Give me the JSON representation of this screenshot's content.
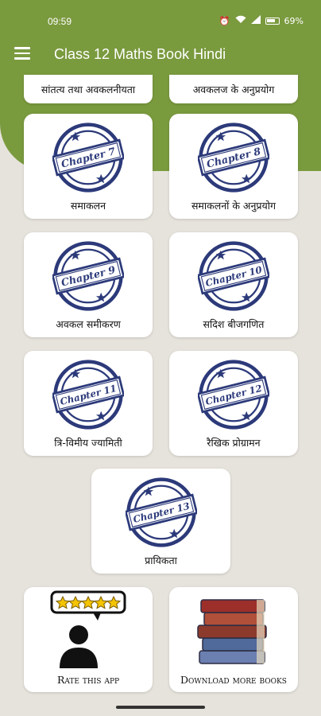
{
  "statusbar": {
    "time": "09:59",
    "battery": "69%"
  },
  "appbar": {
    "title": "Class 12 Maths Book Hindi"
  },
  "top_cards": [
    {
      "label": "सांतत्य तथा अवकलनीयता"
    },
    {
      "label": "अवकलज के अनुप्रयोग"
    }
  ],
  "chapters": [
    {
      "stamp": "Chapter 7",
      "label": "समाकलन"
    },
    {
      "stamp": "Chapter 8",
      "label": "समाकलनों के अनुप्रयोग"
    },
    {
      "stamp": "Chapter 9",
      "label": "अवकल समीकरण"
    },
    {
      "stamp": "Chapter 10",
      "label": "सदिश बीजगणित"
    },
    {
      "stamp": "Chapter 11",
      "label": "त्रि-विमीय ज्यामिती"
    },
    {
      "stamp": "Chapter 12",
      "label": "रैखिक प्रोग्रामन"
    },
    {
      "stamp": "Chapter 13",
      "label": "प्रायिकता"
    }
  ],
  "rate": {
    "label": "Rate this app",
    "stars": 5
  },
  "download": {
    "label": "Download more books"
  },
  "colors": {
    "header": "#7a9a3e",
    "stamp": "#2c3a7a",
    "background": "#e6e3dc"
  }
}
